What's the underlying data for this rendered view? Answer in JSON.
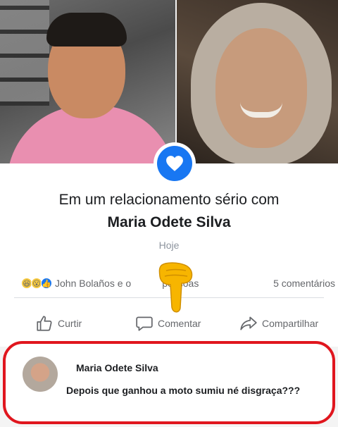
{
  "status": {
    "title_line1": "Em um relacionamento sério com",
    "partner_name": "Maria Odete Silva",
    "date": "Hoje"
  },
  "reactions": {
    "icons": [
      "haha-icon",
      "wow-icon",
      "like-icon"
    ],
    "text_part1": "John Bolaños e o",
    "text_part2": "pessoas",
    "comments_count": "5 comentários"
  },
  "actions": {
    "like_label": "Curtir",
    "comment_label": "Comentar",
    "share_label": "Compartilhar"
  },
  "comment": {
    "author": "Maria Odete Silva",
    "text": "Depois que ganhou a moto sumiu né disgraça???"
  },
  "colors": {
    "facebook_blue": "#1877f2",
    "highlight_red": "#e0161e"
  }
}
